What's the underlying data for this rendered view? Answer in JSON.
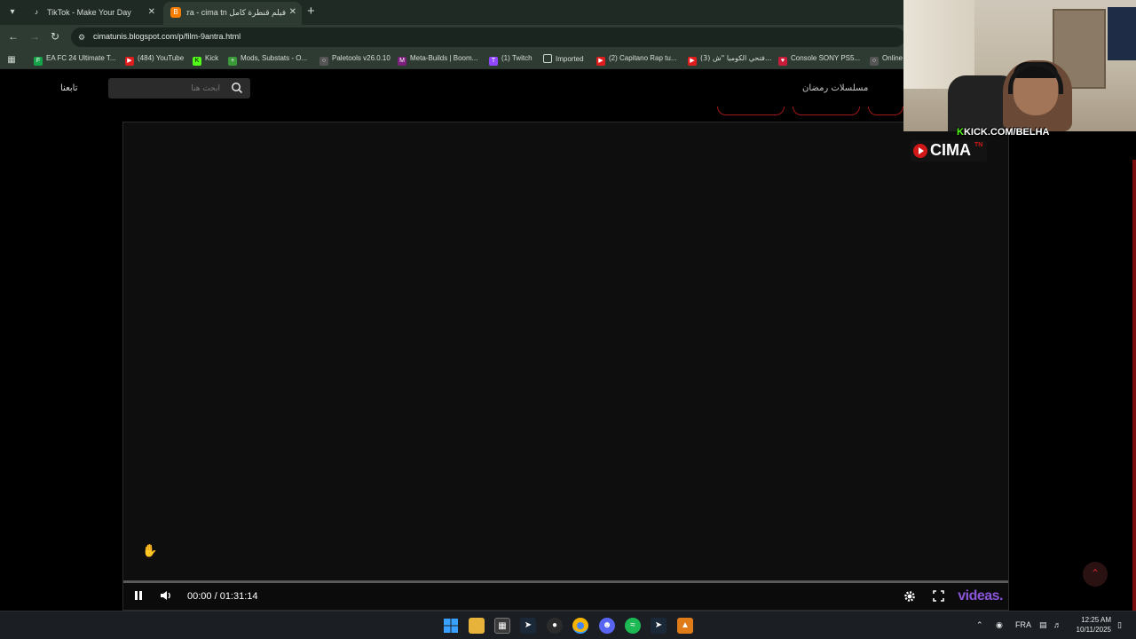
{
  "browser": {
    "tabs": [
      {
        "title": "TikTok - Make Your Day",
        "active": false
      },
      {
        "title": "فيلم قنطرة كامل ntra - cima tn",
        "active": true
      }
    ],
    "url": "cimatunis.blogspot.com/p/film-9antra.html",
    "bookmarks": [
      "EA FC 24 Ultimate T...",
      "(484) YouTube",
      "Kick",
      "Mods, Substats - O...",
      "Paletools v26.0.10",
      "Meta-Builds | Boom...",
      "(1) Twitch",
      "Imported",
      "(2) Capitano Rap tu...",
      "(3) فتحي الكوميا \"ش...",
      "Console SONY PS5...",
      "Online"
    ]
  },
  "site": {
    "follow_label": "تابعنا",
    "search_placeholder": "ابحث هنا",
    "nav_item": "مسلسلات رمضان"
  },
  "player": {
    "time": "00:00 / 01:31:14",
    "progress": 0,
    "brand": "videas."
  },
  "overlay": {
    "kick_handle": "KICK.COM/BELHA",
    "logo_text": "CIMA",
    "logo_suffix": "TN"
  },
  "taskbar": {
    "language": "FRA",
    "time": "12:25 AM",
    "date": "10/11/2025"
  }
}
